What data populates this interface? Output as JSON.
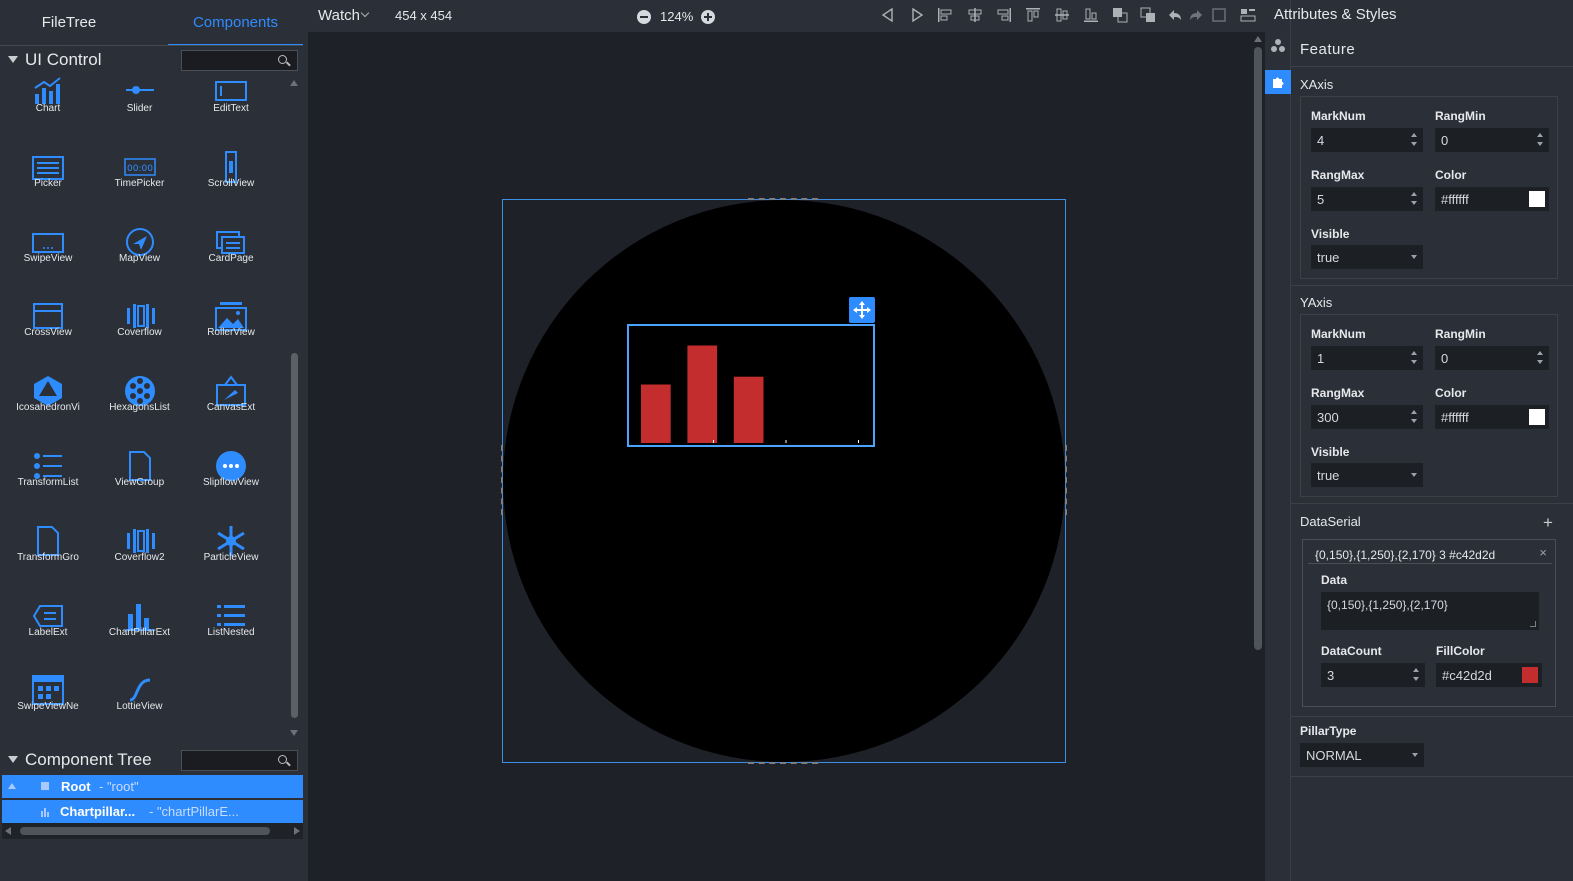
{
  "left_panel": {
    "tabs": [
      {
        "label": "FileTree",
        "active": false
      },
      {
        "label": "Components",
        "active": true
      }
    ],
    "ui_control": {
      "title": "UI Control",
      "search_value": "",
      "components": [
        {
          "label": "Chart",
          "icon": "chart-icon"
        },
        {
          "label": "Slider",
          "icon": "slider-icon"
        },
        {
          "label": "EditText",
          "icon": "edittext-icon"
        },
        {
          "label": "Picker",
          "icon": "picker-icon"
        },
        {
          "label": "TimePicker",
          "icon": "timepicker-icon"
        },
        {
          "label": "ScrollView",
          "icon": "scrollview-icon"
        },
        {
          "label": "SwipeView",
          "icon": "swipeview-icon"
        },
        {
          "label": "MapView",
          "icon": "mapview-icon"
        },
        {
          "label": "CardPage",
          "icon": "cardpage-icon"
        },
        {
          "label": "CrossView",
          "icon": "crossview-icon"
        },
        {
          "label": "Coverflow",
          "icon": "coverflow-icon"
        },
        {
          "label": "RollerView",
          "icon": "rollerview-icon"
        },
        {
          "label": "IcosahedronVi",
          "icon": "icosahedron-icon"
        },
        {
          "label": "HexagonsList",
          "icon": "hexagonslist-icon"
        },
        {
          "label": "CanvasExt",
          "icon": "canvasext-icon"
        },
        {
          "label": "TransformList",
          "icon": "transformlist-icon"
        },
        {
          "label": "ViewGroup",
          "icon": "viewgroup-icon"
        },
        {
          "label": "SlipflowView",
          "icon": "slipflowview-icon"
        },
        {
          "label": "TransformGro",
          "icon": "transformgroup-icon"
        },
        {
          "label": "Coverflow2",
          "icon": "coverflow2-icon"
        },
        {
          "label": "ParticleView",
          "icon": "particleview-icon"
        },
        {
          "label": "LabelExt",
          "icon": "labelext-icon"
        },
        {
          "label": "ChartPillarExt",
          "icon": "chartpillarext-icon"
        },
        {
          "label": "ListNested",
          "icon": "listnested-icon"
        },
        {
          "label": "SwipeViewNe",
          "icon": "swipeviewnested-icon"
        },
        {
          "label": "LottieView",
          "icon": "lottieview-icon"
        }
      ]
    },
    "component_tree": {
      "title": "Component Tree",
      "search_value": "",
      "rows": [
        {
          "name": "Root",
          "id": "- \"root\""
        },
        {
          "name": "Chartpillar...",
          "id": "- \"chartPillarE..."
        }
      ]
    }
  },
  "toolbar": {
    "device": "Watch",
    "dimensions": "454 x 454",
    "zoom": "124%",
    "icons": [
      "prev-icon",
      "play-icon",
      "align-left-icon",
      "align-hcenter-icon",
      "align-right-icon",
      "align-top-icon",
      "align-vcenter-icon",
      "align-bottom-icon",
      "bring-front-icon",
      "send-back-icon",
      "undo-icon",
      "redo-icon",
      "select-box-icon",
      "layout-icon"
    ]
  },
  "canvas": {
    "accent": "#3b8fe6"
  },
  "chart_data": {
    "type": "bar",
    "x": [
      0,
      1,
      2
    ],
    "values": [
      150,
      250,
      170
    ],
    "color": "#c42d2d",
    "xlim": [
      0,
      5
    ],
    "ylim": [
      0,
      300
    ],
    "x_mark_num": 4,
    "y_mark_num": 1
  },
  "right_panel": {
    "title": "Attributes & Styles",
    "section": "Feature",
    "xaxis": {
      "title": "XAxis",
      "markNum_label": "MarkNum",
      "markNum": "4",
      "rangMin_label": "RangMin",
      "rangMin": "0",
      "rangMax_label": "RangMax",
      "rangMax": "5",
      "color_label": "Color",
      "color": "#ffffff",
      "visible_label": "Visible",
      "visible": "true"
    },
    "yaxis": {
      "title": "YAxis",
      "markNum_label": "MarkNum",
      "markNum": "1",
      "rangMin_label": "RangMin",
      "rangMin": "0",
      "rangMax_label": "RangMax",
      "rangMax": "300",
      "color_label": "Color",
      "color": "#ffffff",
      "visible_label": "Visible",
      "visible": "true"
    },
    "dataserial": {
      "title": "DataSerial",
      "add": "+",
      "item": {
        "summary": "{0,150},{1,250},{2,170} 3 #c42d2d",
        "close": "×",
        "data_label": "Data",
        "data": "{0,150},{1,250},{2,170}",
        "count_label": "DataCount",
        "count": "3",
        "fill_label": "FillColor",
        "fill": "#c42d2d"
      }
    },
    "pillar": {
      "title": "PillarType",
      "value": "NORMAL"
    }
  }
}
